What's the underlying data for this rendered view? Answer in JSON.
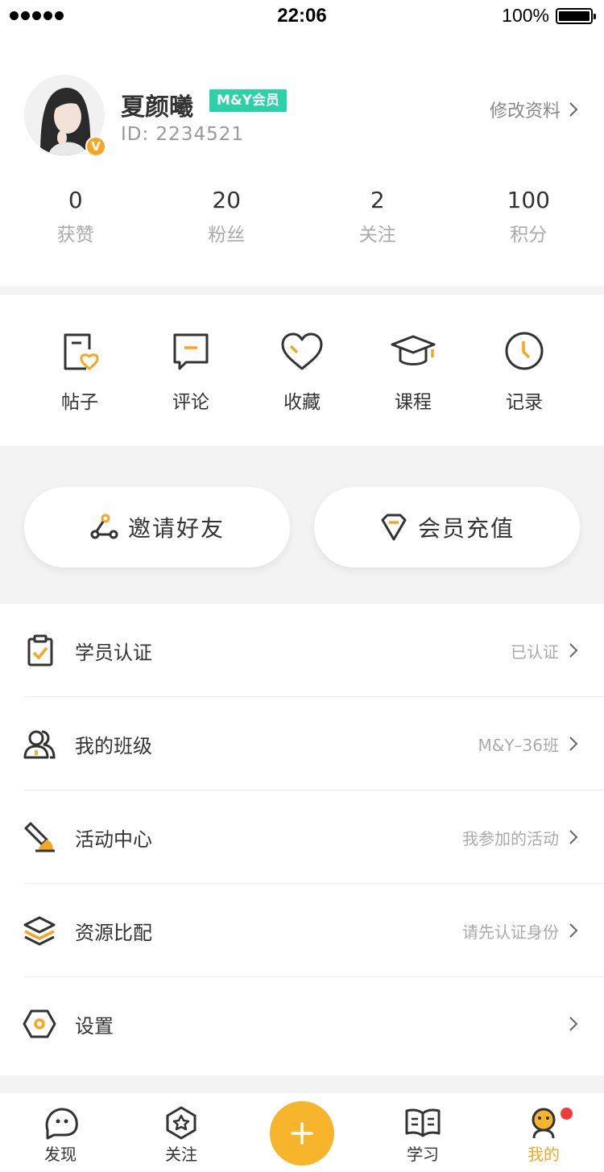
{
  "status_bar": {
    "time": "22:06",
    "battery": "100%"
  },
  "profile": {
    "name": "夏颜曦",
    "vip_tag": "M&Y会员",
    "id_text": "ID:  2234521",
    "badge": "V",
    "edit_label": "修改资料",
    "stats": [
      {
        "value": "0",
        "label": "获赞"
      },
      {
        "value": "20",
        "label": "粉丝"
      },
      {
        "value": "2",
        "label": "关注"
      },
      {
        "value": "100",
        "label": "积分"
      }
    ]
  },
  "quick_links": [
    {
      "label": "帖子",
      "icon": "post-icon"
    },
    {
      "label": "评论",
      "icon": "comment-icon"
    },
    {
      "label": "收藏",
      "icon": "favorite-icon"
    },
    {
      "label": "课程",
      "icon": "course-icon"
    },
    {
      "label": "记录",
      "icon": "history-clock-icon"
    }
  ],
  "actions": {
    "invite_label": "邀请好友",
    "recharge_label": "会员充值"
  },
  "menu": [
    {
      "label": "学员认证",
      "value": "已认证",
      "icon": "clipboard-check-icon"
    },
    {
      "label": "我的班级",
      "value": "M&Y–36班",
      "icon": "users-icon"
    },
    {
      "label": "活动中心",
      "value": "我参加的活动",
      "icon": "brush-icon"
    },
    {
      "label": "资源比配",
      "value": "请先认证身份",
      "icon": "layers-icon"
    },
    {
      "label": "设置",
      "value": "",
      "icon": "settings-hexagon-icon"
    }
  ],
  "tabbar": {
    "items": [
      {
        "label": "发现",
        "icon": "discover-icon"
      },
      {
        "label": "关注",
        "icon": "follow-star-icon"
      },
      {
        "label": "学习",
        "icon": "book-icon"
      },
      {
        "label": "我的",
        "icon": "me-icon"
      }
    ],
    "active_index": 3
  },
  "colors": {
    "accent": "#f6a623",
    "vip": "#2bd2a8",
    "notification": "#f43b3b"
  }
}
